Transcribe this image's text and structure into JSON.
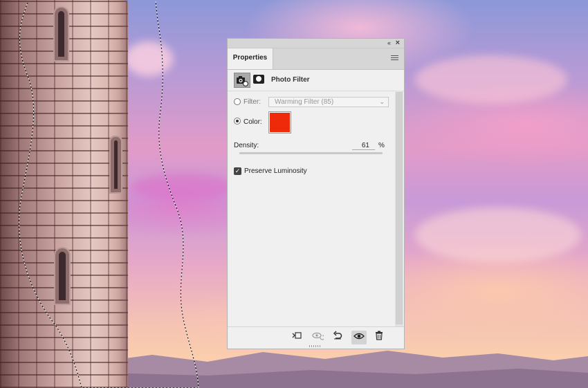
{
  "panel": {
    "collapse_glyph": "«",
    "close_glyph": "×",
    "tab_label": "Properties",
    "adjustment_title": "Photo Filter",
    "filter": {
      "label": "Filter:",
      "value": "Warming Filter (85)",
      "selected": false
    },
    "color": {
      "label": "Color:",
      "value": "#ee2a0b",
      "selected": true
    },
    "density": {
      "label": "Density:",
      "value": "61",
      "unit": "%",
      "fraction": 0.61
    },
    "preserve_luminosity": {
      "label": "Preserve Luminosity",
      "checked": true
    },
    "toolbar": [
      "clip-to-layer-icon",
      "view-previous-state-icon",
      "reset-icon",
      "toggle-visibility-icon",
      "delete-icon"
    ]
  },
  "colors": {
    "panel_bg": "#f0f0f0",
    "tab_bar_bg": "#d6d6d6",
    "swatch_red": "#ee2a0b"
  }
}
